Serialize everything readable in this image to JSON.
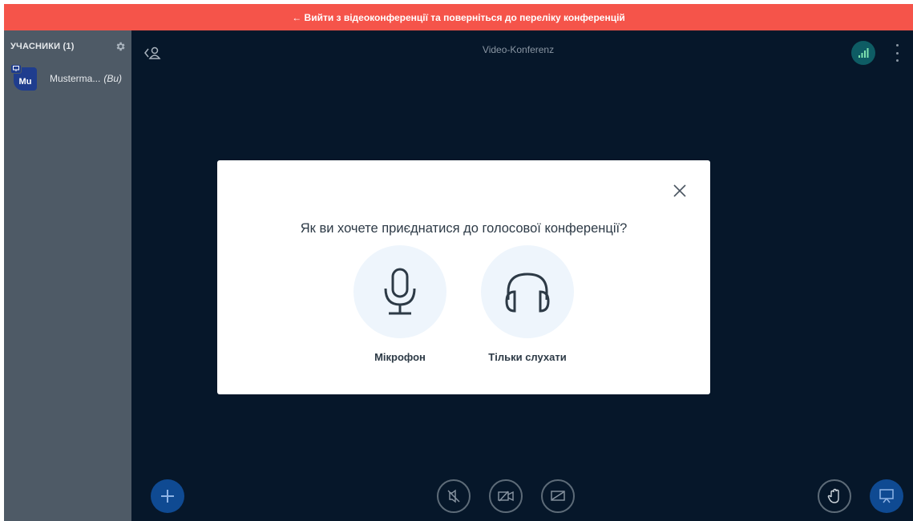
{
  "banner": {
    "text": "← Вийти з відеоконференції та поверніться до переліку конференцій"
  },
  "sidebar": {
    "title": "УЧАСНИКИ (1)",
    "settings_icon": "gear-icon",
    "participants": [
      {
        "initials": "Mu",
        "name": "Musterma...",
        "you_label": "(Ви)",
        "presenter_icon": "presentation-icon"
      }
    ]
  },
  "topbar": {
    "title": "Video-Konferenz",
    "toggle_icon": "users-toggle-icon",
    "connection_icon": "signal-bars-icon",
    "more_icon": "vertical-ellipsis-icon"
  },
  "modal": {
    "title": "Як ви хочете приєднатися до голосової конференції?",
    "close_icon": "close-icon",
    "options": [
      {
        "label": "Мікрофон",
        "icon": "microphone-icon"
      },
      {
        "label": "Тільки слухати",
        "icon": "headphones-icon"
      }
    ]
  },
  "actions": {
    "add_icon": "plus-icon",
    "audio_icon": "audio-muted-icon",
    "video_icon": "video-off-icon",
    "screenshare_icon": "screenshare-off-icon",
    "raise_hand_icon": "hand-icon",
    "presentation_icon": "presentation-icon"
  },
  "colors": {
    "banner": "#f5544a",
    "main_bg": "#06172a",
    "sidebar_bg": "#4e5a66",
    "accent_blue": "#0f4a92",
    "modal_circle": "#eef5fc"
  }
}
